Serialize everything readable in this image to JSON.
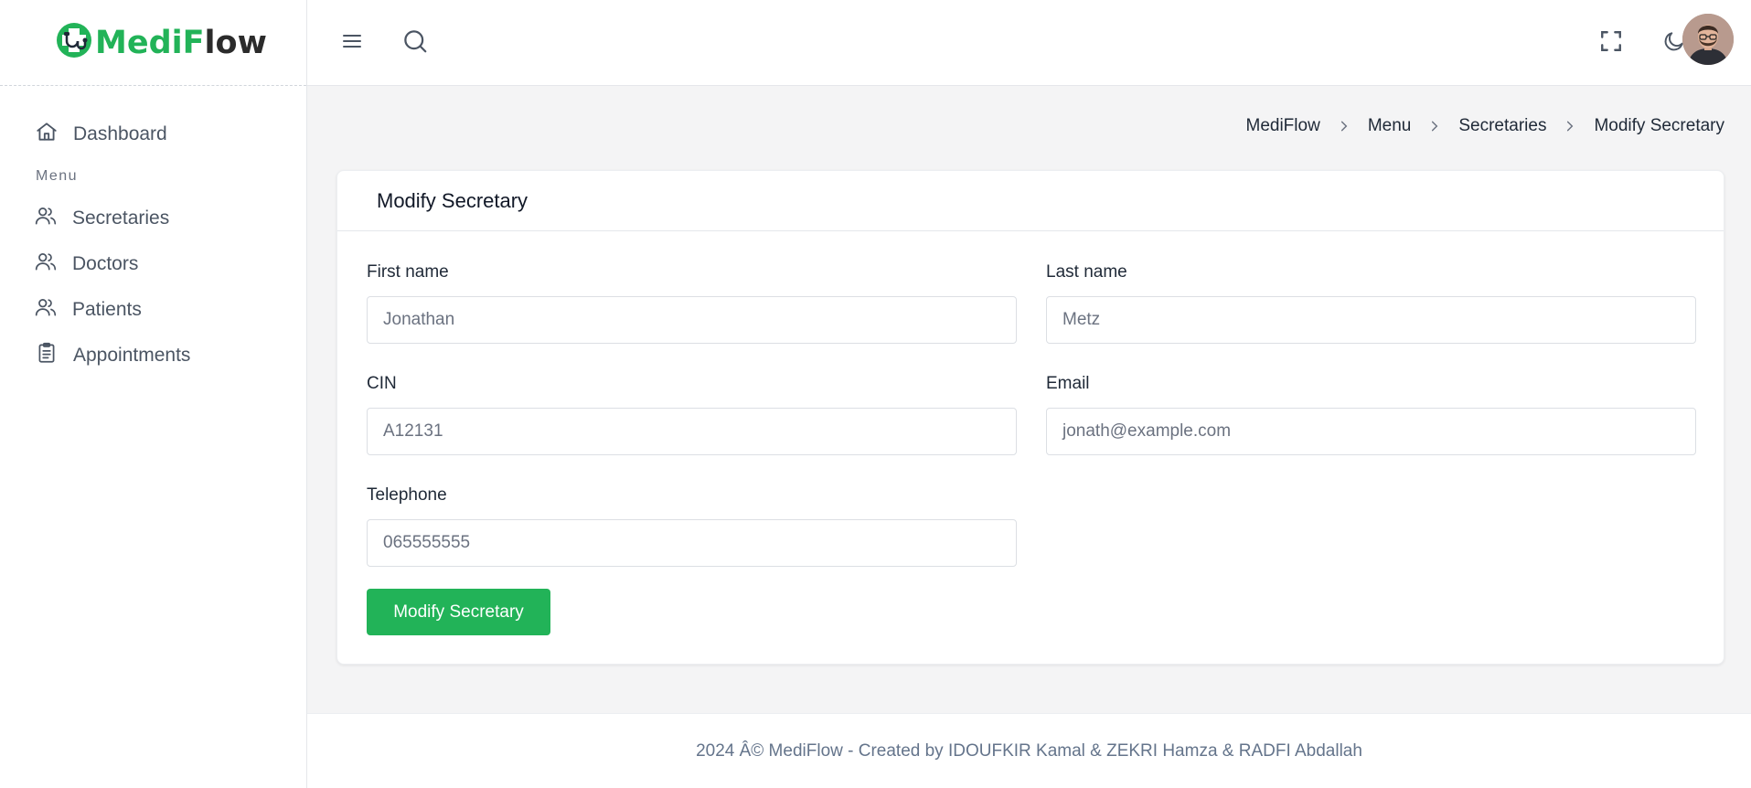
{
  "brand": {
    "name_part1": "Medi",
    "name_part2": "Flow",
    "accent_color": "#22b358"
  },
  "sidebar": {
    "items": [
      {
        "label": "Dashboard",
        "icon": "home-icon"
      }
    ],
    "section_label": "Menu",
    "menu_items": [
      {
        "label": "Secretaries",
        "icon": "users-icon"
      },
      {
        "label": "Doctors",
        "icon": "users-icon"
      },
      {
        "label": "Patients",
        "icon": "users-icon"
      },
      {
        "label": "Appointments",
        "icon": "clipboard-icon"
      }
    ]
  },
  "header": {
    "icons": [
      "menu-icon",
      "search-icon",
      "fullscreen-icon",
      "moon-icon"
    ]
  },
  "breadcrumb": [
    "MediFlow",
    "Menu",
    "Secretaries",
    "Modify Secretary"
  ],
  "card": {
    "title": "Modify Secretary",
    "fields": {
      "first_name": {
        "label": "First name",
        "placeholder": "Jonathan"
      },
      "last_name": {
        "label": "Last name",
        "placeholder": "Metz"
      },
      "cin": {
        "label": "CIN",
        "placeholder": "A12131"
      },
      "email": {
        "label": "Email",
        "placeholder": "jonath@example.com"
      },
      "telephone": {
        "label": "Telephone",
        "placeholder": "065555555"
      }
    },
    "submit_label": "Modify Secretary"
  },
  "footer": {
    "text": "2024 Â© MediFlow - Created by IDOUFKIR Kamal & ZEKRI Hamza & RADFI Abdallah"
  }
}
